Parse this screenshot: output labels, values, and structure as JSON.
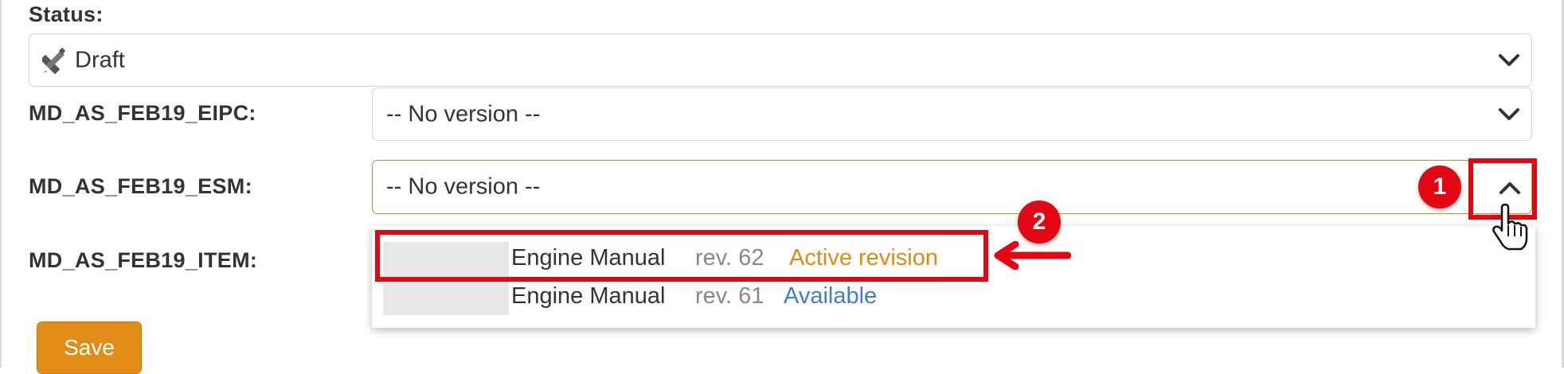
{
  "status": {
    "label": "Status:",
    "value": "Draft",
    "icon": "pencil-ruler-icon"
  },
  "fields": [
    {
      "label": "MD_AS_FEB19_EIPC:",
      "value": "-- No version --"
    },
    {
      "label": "MD_AS_FEB19_ESM:",
      "value": "-- No version --"
    },
    {
      "label": "MD_AS_FEB19_ITEM:"
    }
  ],
  "dropdown": {
    "options": [
      {
        "name": "Engine Manual",
        "rev": "rev. 62",
        "status": "Active revision",
        "status_color": "#e08a12"
      },
      {
        "name": "Engine Manual",
        "rev": "rev. 61",
        "status": "Available",
        "status_color": "#3f7fbf"
      }
    ]
  },
  "save_label": "Save",
  "annotations": {
    "step1": "1",
    "step2": "2",
    "color": "#e30613"
  }
}
